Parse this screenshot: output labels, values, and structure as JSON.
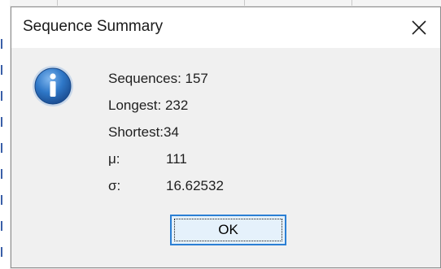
{
  "window": {
    "title": "Sequence Summary",
    "close_icon": "close-icon"
  },
  "message": {
    "icon": "info-icon",
    "sequences": "Sequences: 157",
    "longest": "Longest: 232",
    "shortest": "Shortest:34",
    "mean_label": "μ:",
    "mean_value": "111",
    "stddev_label": "σ:",
    "stddev_value": "16.62532"
  },
  "buttons": {
    "ok_label": "OK"
  },
  "colors": {
    "accent": "#2b7fd4",
    "icon_blue": "#2f78c8",
    "dialog_bg": "#f0f0f0"
  }
}
